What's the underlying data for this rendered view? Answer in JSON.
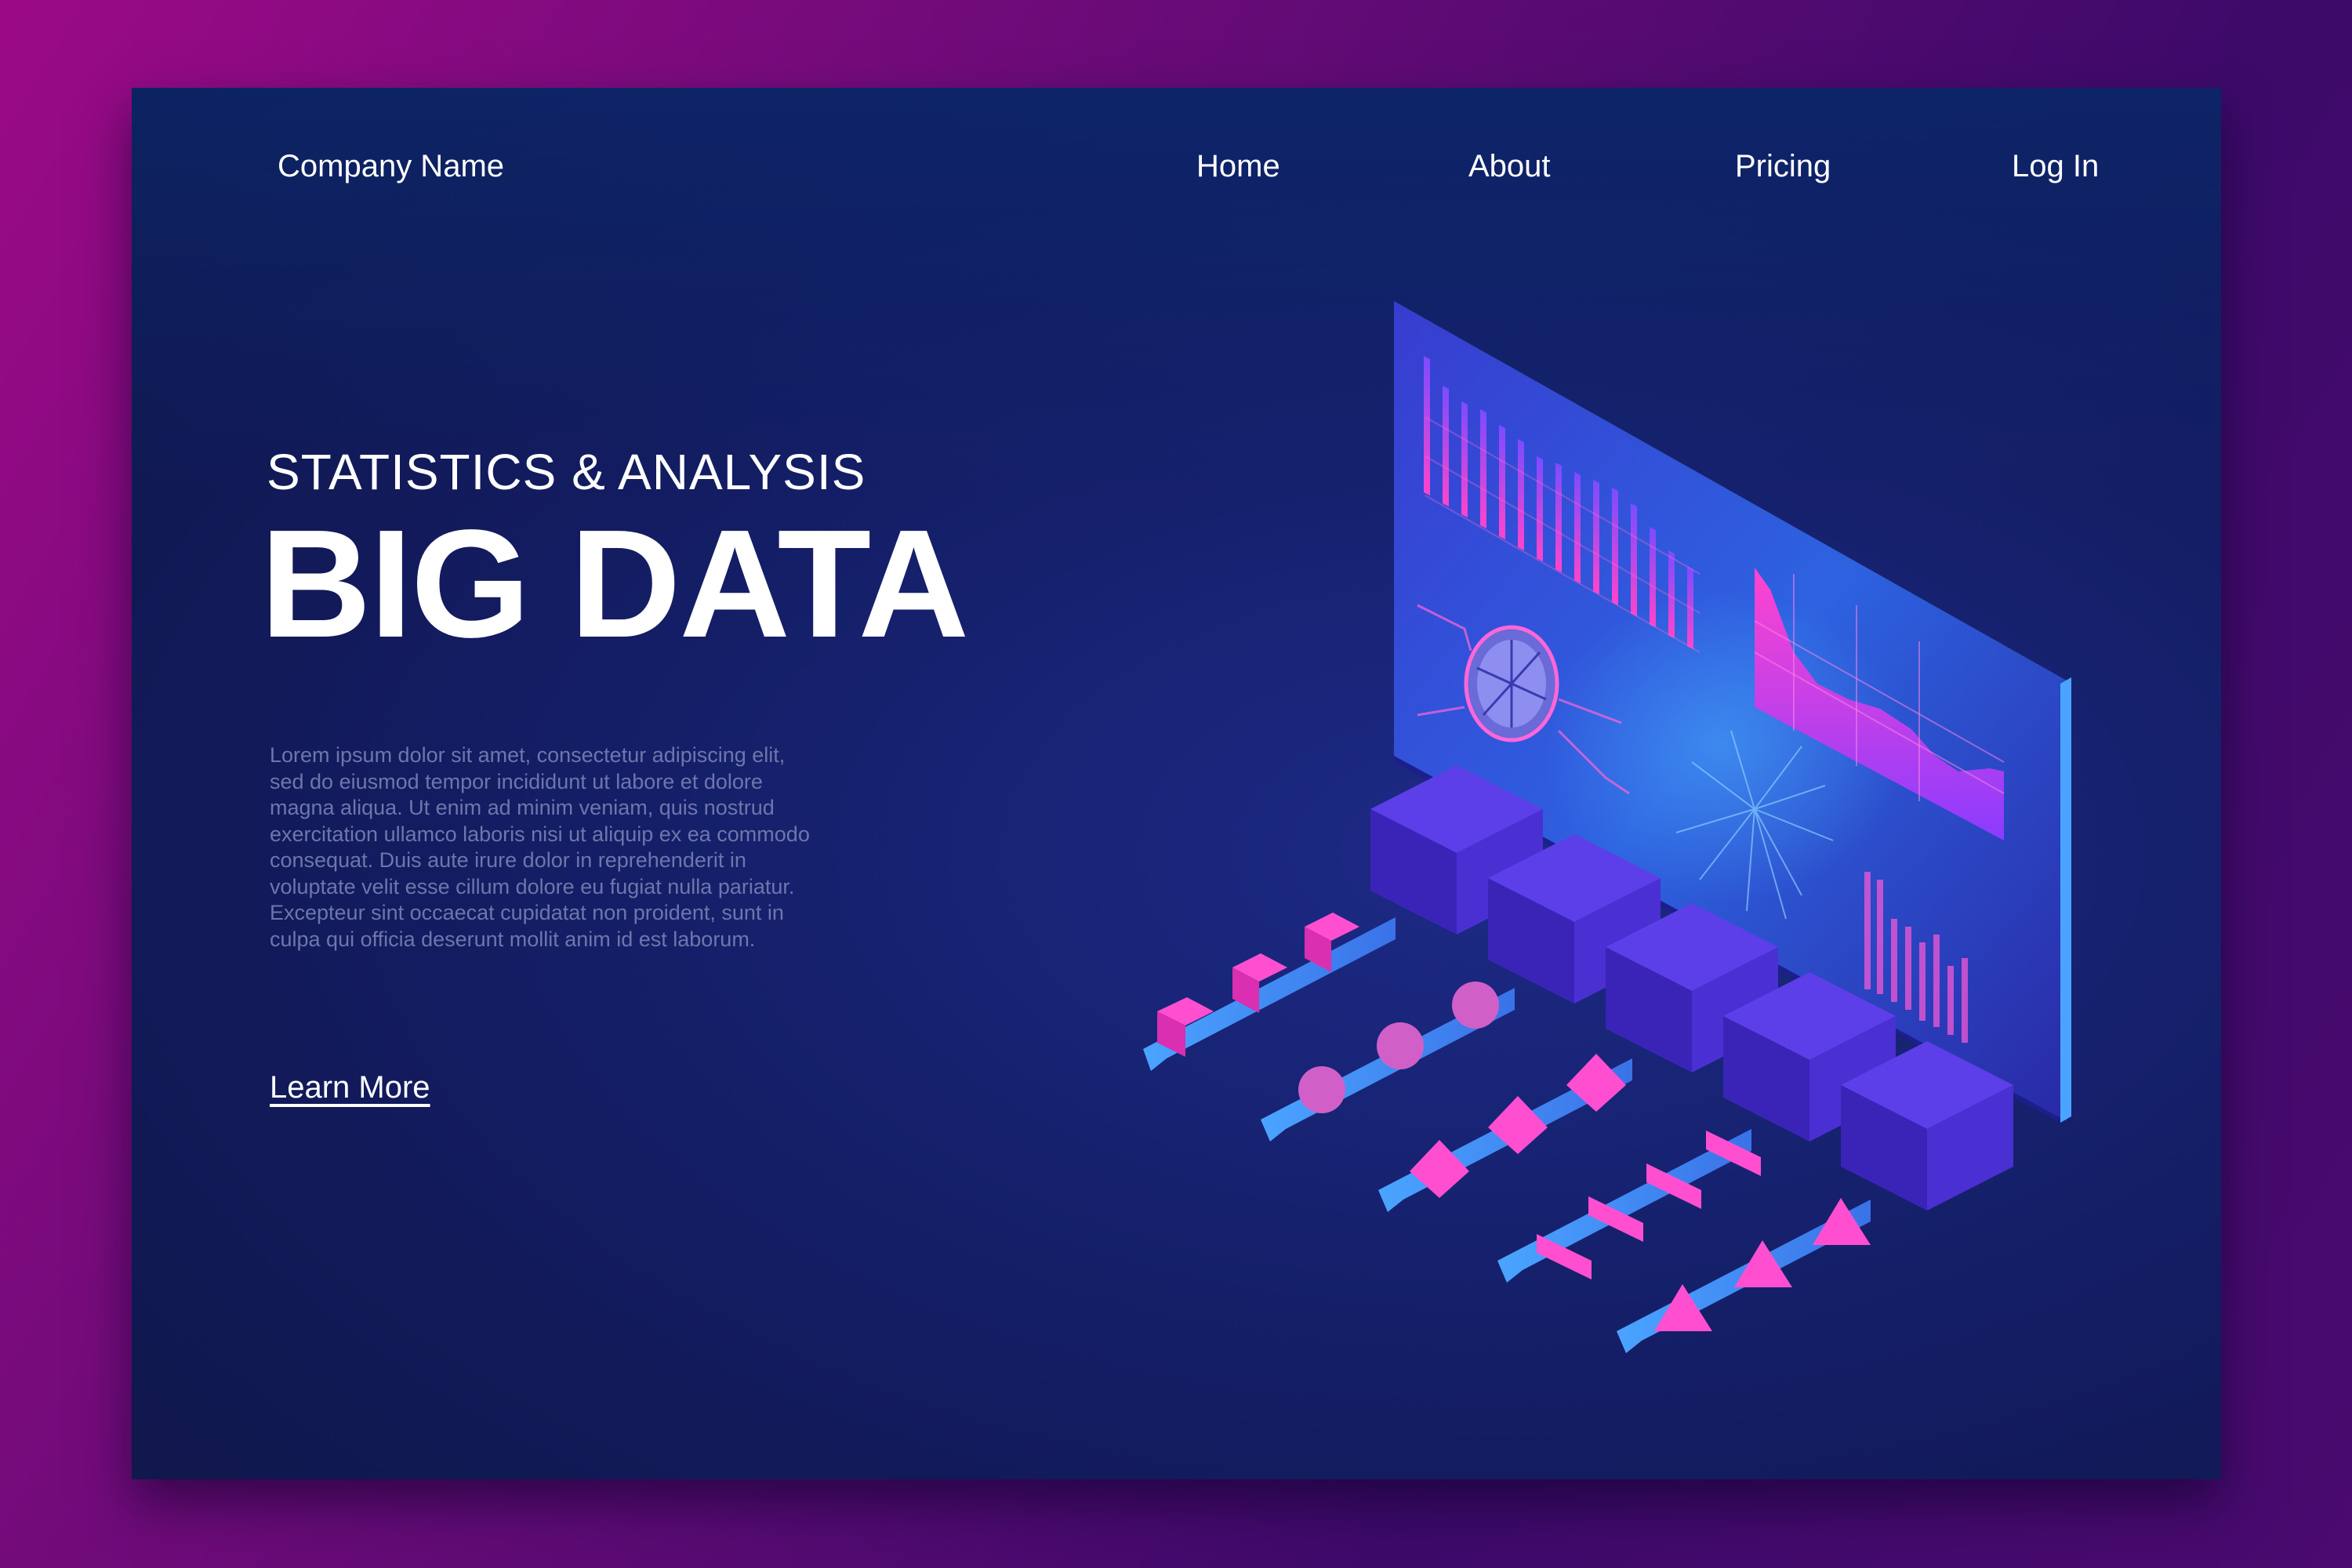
{
  "header": {
    "brand": "Company Name",
    "nav": [
      "Home",
      "About",
      "Pricing",
      "Log In"
    ]
  },
  "hero": {
    "subtitle": "STATISTICS & ANALYSIS",
    "title": "BIG DATA",
    "body": "Lorem ipsum dolor sit amet, consectetur adipiscing elit, sed do eiusmod tempor incididunt ut labore et dolore magna aliqua. Ut enim ad minim veniam, quis nostrud exercitation ullamco laboris nisi ut aliquip ex ea commodo consequat. Duis aute irure dolor in reprehenderit in voluptate velit esse cillum dolore eu fugiat nulla pariatur. Excepteur sint occaecat cupidatat non proident, sunt in culpa qui officia deserunt mollit anim id est laborum.",
    "cta": "Learn More"
  },
  "colors": {
    "background_magenta": "#9b0a87",
    "card_navy": "#121a5a",
    "accent_pink": "#ff3fd0",
    "accent_blue": "#3b8cff"
  }
}
